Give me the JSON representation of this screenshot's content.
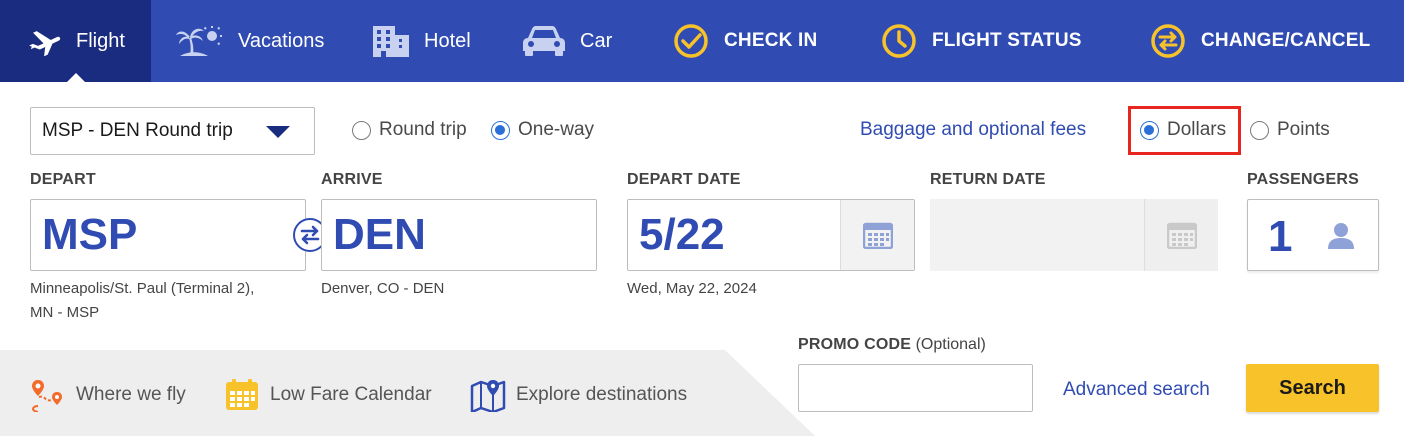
{
  "nav": {
    "items": [
      {
        "label": "Flight",
        "icon": "airplane-icon"
      },
      {
        "label": "Vacations",
        "icon": "palm-tree-icon"
      },
      {
        "label": "Hotel",
        "icon": "hotel-building-icon"
      },
      {
        "label": "Car",
        "icon": "car-icon"
      },
      {
        "label": "CHECK IN",
        "icon": "check-circle-icon"
      },
      {
        "label": "FLIGHT STATUS",
        "icon": "clock-icon"
      },
      {
        "label": "CHANGE/CANCEL",
        "icon": "swap-arrows-icon"
      }
    ]
  },
  "trip": {
    "selected": "MSP - DEN Round trip",
    "radios": [
      {
        "label": "Round trip",
        "checked": false
      },
      {
        "label": "One-way",
        "checked": true
      }
    ]
  },
  "baggage_link": "Baggage and optional fees",
  "currency": [
    {
      "label": "Dollars",
      "checked": true
    },
    {
      "label": "Points",
      "checked": false
    }
  ],
  "depart": {
    "label": "DEPART",
    "code": "MSP",
    "detail_line1": "Minneapolis/St. Paul (Terminal 2),",
    "detail_line2": "MN - MSP"
  },
  "arrive": {
    "label": "ARRIVE",
    "code": "DEN",
    "detail": "Denver, CO - DEN"
  },
  "depart_date": {
    "label": "DEPART DATE",
    "value": "5/22",
    "detail": "Wed, May 22, 2024"
  },
  "return_date": {
    "label": "RETURN DATE"
  },
  "passengers": {
    "label": "PASSENGERS",
    "value": "1"
  },
  "bottom_links": [
    {
      "label": "Where we fly",
      "icon": "route-map-icon"
    },
    {
      "label": "Low Fare Calendar",
      "icon": "calendar-icon"
    },
    {
      "label": "Explore destinations",
      "icon": "map-pin-icon"
    }
  ],
  "promo": {
    "label": "PROMO CODE",
    "optional": "(Optional)",
    "value": ""
  },
  "advanced_search": "Advanced search",
  "search_button": "Search",
  "colors": {
    "nav_bg": "#304cb2",
    "nav_active": "#1a2c80",
    "accent_yellow": "#f8c22b",
    "highlight_red": "#e8261f",
    "link_blue": "#304cb2"
  }
}
